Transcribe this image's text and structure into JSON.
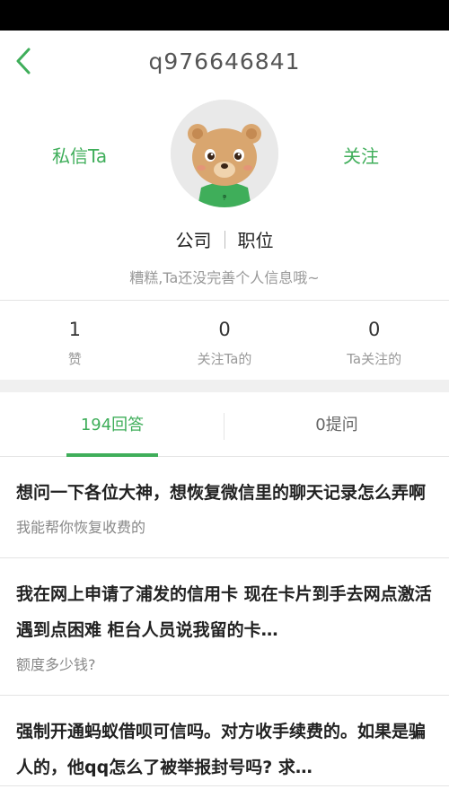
{
  "header": {
    "title": "q976646841"
  },
  "profile": {
    "message_label": "私信Ta",
    "follow_label": "关注",
    "company": "公司",
    "position": "职位",
    "bio": "糟糕,Ta还没完善个人信息哦~"
  },
  "stats": [
    {
      "value": "1",
      "label": "赞"
    },
    {
      "value": "0",
      "label": "关注Ta的"
    },
    {
      "value": "0",
      "label": "Ta关注的"
    }
  ],
  "tabs": [
    {
      "label": "194回答",
      "active": true
    },
    {
      "label": "0提问",
      "active": false
    }
  ],
  "qa": [
    {
      "question": "想问一下各位大神，想恢复微信里的聊天记录怎么弄啊",
      "answer": "我能帮你恢复收费的"
    },
    {
      "question": "我在网上申请了浦发的信用卡  现在卡片到手去网点激活遇到点困难  柜台人员说我留的卡…",
      "answer": "额度多少钱?"
    },
    {
      "question": "强制开通蚂蚁借呗可信吗。对方收手续费的。如果是骗人的，他qq怎么了被举报封号吗? 求…",
      "answer": ""
    }
  ],
  "colors": {
    "accent": "#3fae5a",
    "bear": "#d9a66f",
    "shirt": "#3fae5a"
  },
  "icons": {
    "back": "chevron-left-icon"
  }
}
